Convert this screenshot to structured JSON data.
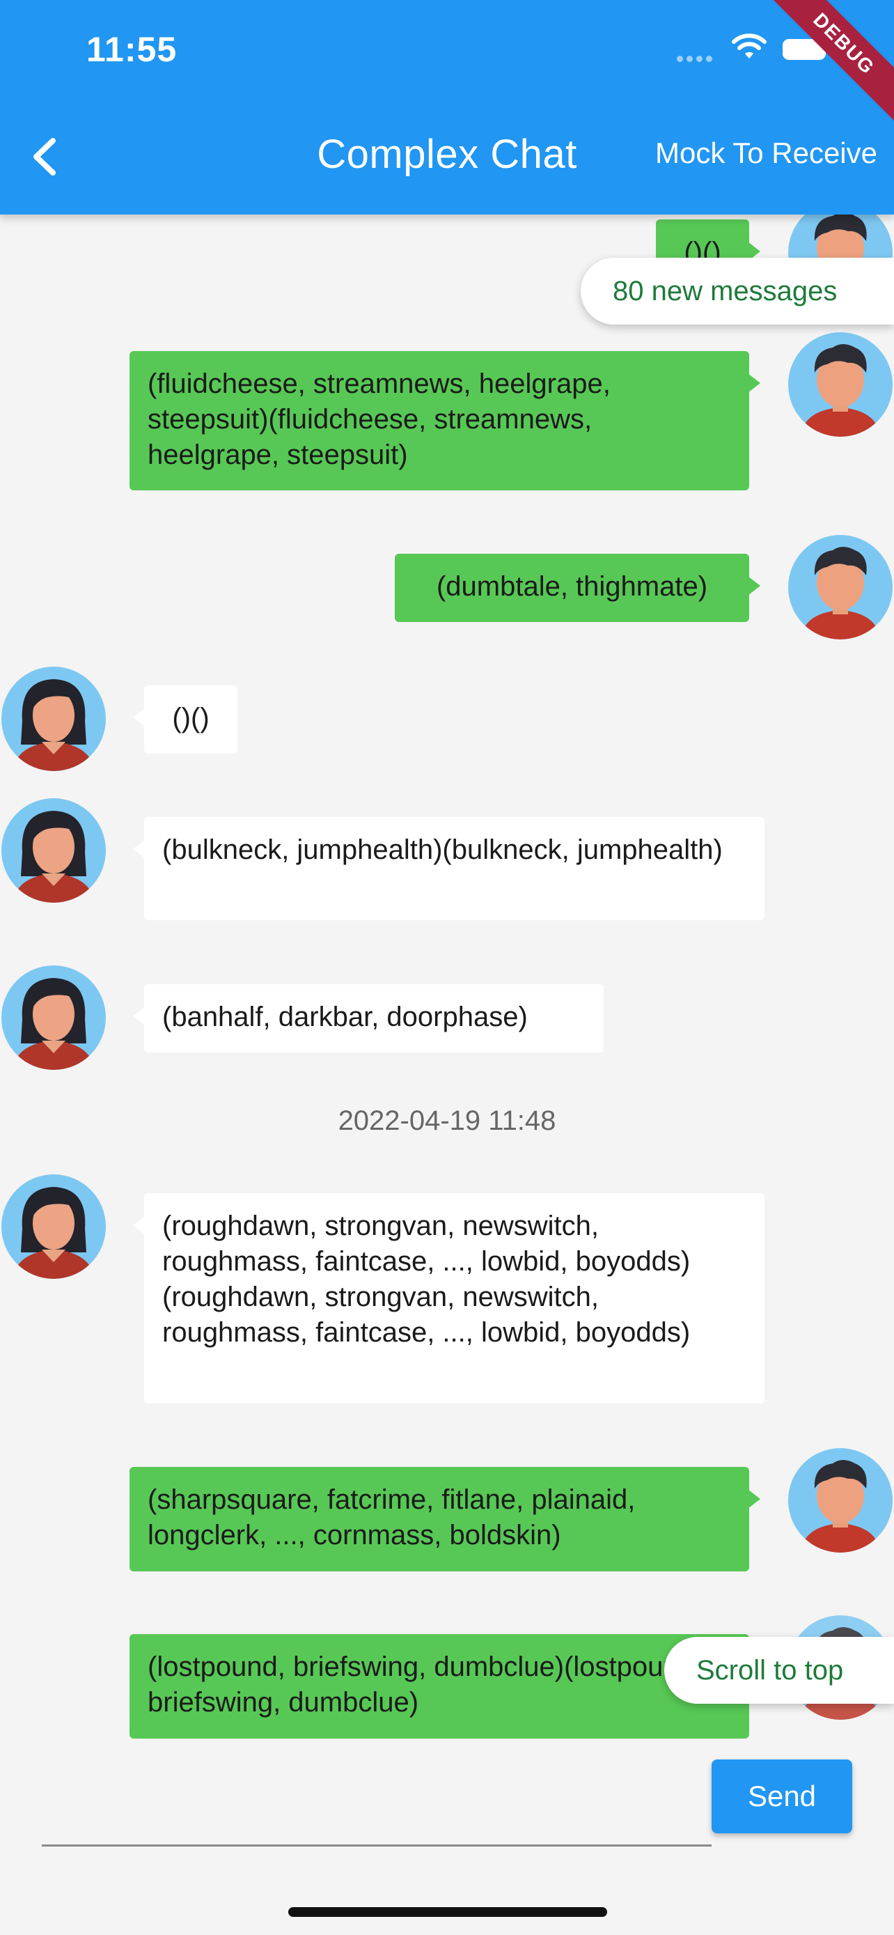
{
  "status_bar": {
    "time": "11:55"
  },
  "app_bar": {
    "title": "Complex Chat",
    "action": "Mock To Receive",
    "debug_banner": "DEBUG"
  },
  "new_messages_label": "80 new messages",
  "scroll_to_top_label": "Scroll to top",
  "messages": [
    {
      "type": "sent",
      "text": "()()"
    },
    {
      "type": "sent",
      "text": "(fluidcheese, streamnews, heelgrape, steepsuit)(fluidcheese, streamnews, heelgrape, steepsuit)"
    },
    {
      "type": "sent",
      "text": "(dumbtale, thighmate)"
    },
    {
      "type": "received",
      "text": "()()"
    },
    {
      "type": "received",
      "text": "(bulkneck, jumphealth)(bulkneck, jumphealth)"
    },
    {
      "type": "received",
      "text": "(banhalf, darkbar, doorphase)"
    },
    {
      "type": "timestamp",
      "text": "2022-04-19 11:48"
    },
    {
      "type": "received",
      "text": "(roughdawn, strongvan, newswitch, roughmass, faintcase, ..., lowbid, boyodds)(roughdawn, strongvan, newswitch, roughmass, faintcase, ..., lowbid, boyodds)"
    },
    {
      "type": "sent",
      "text": "(sharpsquare, fatcrime, fitlane, plainaid, longclerk, ..., cornmass, boldskin)"
    },
    {
      "type": "sent",
      "text": "(lostpound, briefswing, dumbclue)(lostpound, briefswing, dumbclue)"
    }
  ],
  "composer": {
    "input_value": "",
    "send_label": "Send"
  },
  "colors": {
    "app_bar": "#2196f3",
    "sent_bubble": "#57c855",
    "received_bubble": "#ffffff",
    "background": "#f4f4f4"
  }
}
